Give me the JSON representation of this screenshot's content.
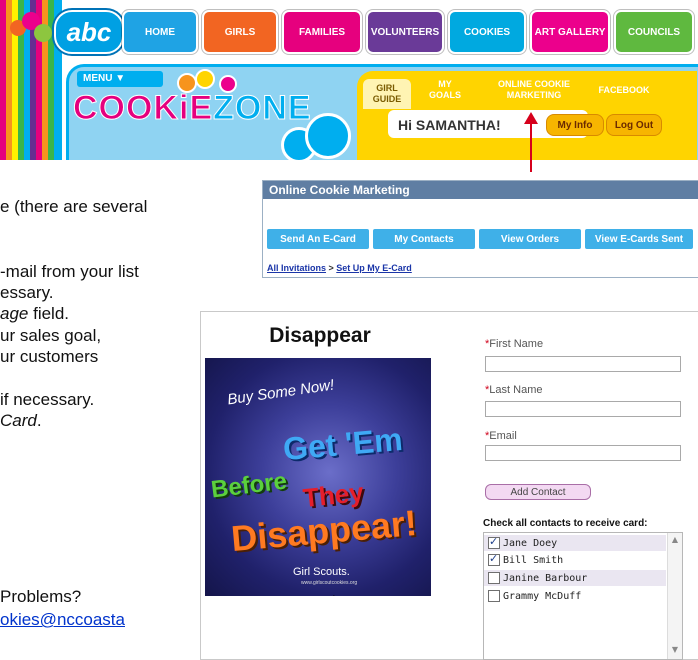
{
  "header": {
    "logo_text": "abc",
    "nav_tabs": [
      {
        "label": "HOME",
        "color": "#1fa3e4"
      },
      {
        "label": "GIRLS",
        "color": "#f26522"
      },
      {
        "label": "FAMILIES",
        "color": "#e6007e"
      },
      {
        "label": "VOLUNTEERS",
        "color": "#6a3a98"
      },
      {
        "label": "COOKIES",
        "color": "#00a9e0"
      },
      {
        "label": "ART GALLERY",
        "color": "#ec008c"
      },
      {
        "label": "COUNCILS",
        "color": "#5fb93f"
      }
    ],
    "menu_label": "MENU ▼",
    "cookiezone_part1": "COOKiE",
    "cookiezone_part2": "ZONE",
    "subnav": [
      {
        "label": "GIRL\nGUIDE",
        "active": true
      },
      {
        "label": "MY\nGOALS",
        "active": false
      },
      {
        "label": "ONLINE COOKIE\nMARKETING",
        "active": false
      },
      {
        "label": "FACEBOOK",
        "active": false
      }
    ],
    "greeting": "Hi SAMANTHA!",
    "my_info_label": "My Info",
    "logout_label": "Log Out"
  },
  "instructions": {
    "line1": "e (there are several",
    "line2": "-mail from your list",
    "line3": "essary.",
    "line4_em": "age",
    "line4_rest": " field.",
    "line5": "ur sales goal,",
    "line6": "ur customers",
    "line7": "if necessary.",
    "line8_em": "Card",
    "line8_rest": ".",
    "line9": "Problems?",
    "line10_link": "okies@nccoasta"
  },
  "ocm": {
    "title": "Online Cookie Marketing",
    "tabs": [
      "Send An E-Card",
      "My Contacts",
      "View Orders",
      "View E-Cards Sent"
    ],
    "crumb_link1": "All Invitations",
    "crumb_sep": " > ",
    "crumb_link2": "Set Up My E-Card"
  },
  "ecard": {
    "title": "Disappear",
    "card": {
      "buy": "Buy Some Now!",
      "line1": "Get 'Em",
      "line2a": "Before",
      "line2b": "They",
      "line3": "Disappear!",
      "brand": "Girl Scouts.",
      "url": "www.girlscoutcookies.org"
    },
    "form": {
      "required_mark": "*",
      "first_name_label": "First Name",
      "last_name_label": "Last Name",
      "email_label": "Email",
      "add_contact_label": "Add Contact",
      "check_heading": "Check all contacts to receive card:",
      "contacts": [
        {
          "name": "Jane Doey",
          "checked": true,
          "selected": true
        },
        {
          "name": "Bill Smith",
          "checked": true,
          "selected": false
        },
        {
          "name": "Janine Barbour",
          "checked": false,
          "selected": true
        },
        {
          "name": "Grammy McDuff",
          "checked": false,
          "selected": false
        }
      ]
    }
  }
}
